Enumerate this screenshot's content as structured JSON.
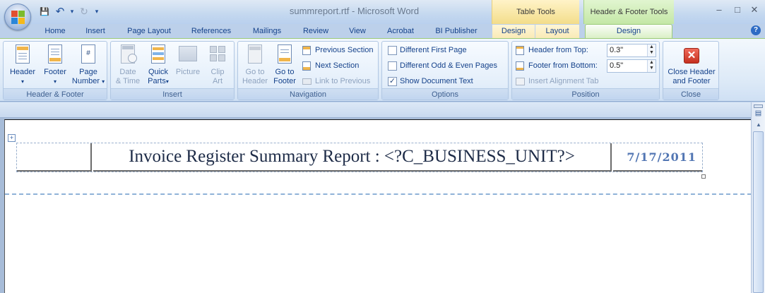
{
  "window": {
    "title": "summreport.rtf - Microsoft Word",
    "context_groups": {
      "table_tools": "Table Tools",
      "header_footer_tools": "Header & Footer Tools"
    },
    "controls": {
      "minimize": "–",
      "maximize": "□",
      "close": "✕"
    }
  },
  "quick_access": {
    "save": "💾",
    "undo": "↶",
    "undo_drop": "▾",
    "redo": "↻",
    "customize": "▾"
  },
  "tabs": [
    "Home",
    "Insert",
    "Page Layout",
    "References",
    "Mailings",
    "Review",
    "View",
    "Acrobat",
    "BI Publisher",
    "Design",
    "Layout",
    "Design"
  ],
  "active_tab": "Design",
  "help": "?",
  "ribbon": {
    "header_footer": {
      "title": "Header & Footer",
      "header": "Header",
      "footer": "Footer",
      "page_number_1": "Page",
      "page_number_2": "Number",
      "dropdown": "▾"
    },
    "insert": {
      "title": "Insert",
      "date_time_1": "Date",
      "date_time_2": "& Time",
      "quick_parts_1": "Quick",
      "quick_parts_2": "Parts",
      "picture": "Picture",
      "clip_art_1": "Clip",
      "clip_art_2": "Art"
    },
    "navigation": {
      "title": "Navigation",
      "goto_header_1": "Go to",
      "goto_header_2": "Header",
      "goto_footer_1": "Go to",
      "goto_footer_2": "Footer",
      "previous_section": "Previous Section",
      "next_section": "Next Section",
      "link_to_previous": "Link to Previous"
    },
    "options": {
      "title": "Options",
      "different_first_page": "Different First Page",
      "different_odd_even": "Different Odd & Even Pages",
      "show_document_text": "Show Document Text",
      "checked_mark": "✓"
    },
    "position": {
      "title": "Position",
      "header_from_top": "Header from Top:",
      "header_from_top_value": "0.3\"",
      "footer_from_bottom": "Footer from Bottom:",
      "footer_from_bottom_value": "0.5\"",
      "insert_alignment_tab": "Insert Alignment Tab",
      "spin_up": "▲",
      "spin_down": "▼"
    },
    "close": {
      "title": "Close",
      "close_header_1": "Close Header",
      "close_header_2": "and Footer"
    }
  },
  "document": {
    "report_title": "Invoice Register Summary Report : <?C_BUSINESS_UNIT?>",
    "report_date": "7/17/2011"
  },
  "colors": {
    "context_table": "#f3dd8a",
    "context_header_footer": "#c4e7a6",
    "date_text": "#5276b3"
  }
}
